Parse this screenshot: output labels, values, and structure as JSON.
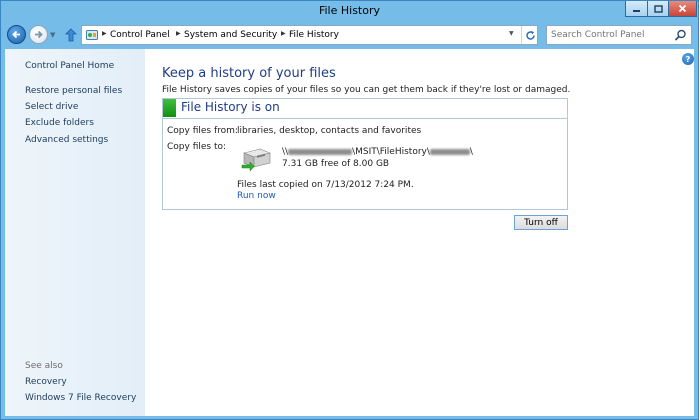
{
  "window": {
    "title": "File History"
  },
  "address": {
    "crumbs": [
      "Control Panel",
      "System and Security",
      "File History"
    ]
  },
  "search": {
    "placeholder": "Search Control Panel"
  },
  "sidebar": {
    "home": "Control Panel Home",
    "items": [
      "Restore personal files",
      "Select drive",
      "Exclude folders",
      "Advanced settings"
    ],
    "see_also_label": "See also",
    "see_also": [
      "Recovery",
      "Windows 7 File Recovery"
    ]
  },
  "main": {
    "heading": "Keep a history of your files",
    "description": "File History saves copies of your files so you can get them back if they're lost or damaged.",
    "status": "File History is on",
    "copy_from_label": "Copy files from:",
    "copy_from_value": "libraries, desktop, contacts and favorites",
    "copy_to_label": "Copy files to:",
    "path_visible": "MSIT\\FileHistory\\",
    "free_space": "7.31 GB free of 8.00 GB",
    "last_copied": "Files last copied on 7/13/2012 7:24 PM.",
    "run_now": "Run now",
    "turn_off": "Turn off"
  },
  "colors": {
    "accent": "#1e3c8a",
    "link": "#1e5ab4",
    "status_green": "#22a822",
    "frame": "#76bce8"
  },
  "icons": [
    "back-arrow-icon",
    "forward-arrow-icon",
    "up-arrow-icon",
    "control-panel-icon",
    "refresh-icon",
    "search-icon",
    "help-icon",
    "drive-icon",
    "minimize-icon",
    "maximize-icon",
    "close-icon"
  ]
}
